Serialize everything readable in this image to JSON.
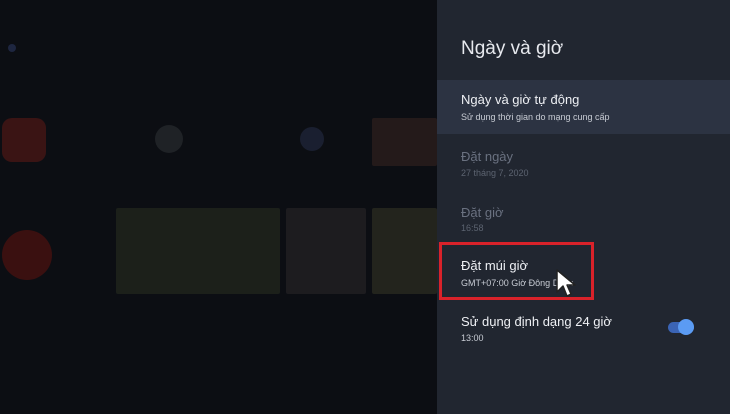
{
  "panel": {
    "title": "Ngày và giờ",
    "items": [
      {
        "title": "Ngày và giờ tự động",
        "subtitle": "Sử dụng thời gian do mạng cung cấp",
        "state": "selected"
      },
      {
        "title": "Đặt ngày",
        "subtitle": "27 tháng 7, 2020",
        "state": "disabled"
      },
      {
        "title": "Đặt giờ",
        "subtitle": "16:58",
        "state": "disabled"
      },
      {
        "title": "Đặt múi giờ",
        "subtitle": "GMT+07:00 Giờ Đông Dương",
        "state": "enabled"
      },
      {
        "title": "Sử dụng định dạng 24 giờ",
        "subtitle": "13:00",
        "state": "enabled",
        "toggle": "on"
      }
    ]
  },
  "colors": {
    "highlight": "#d9222a",
    "toggle_on": "#5b9bf3",
    "panel_bg": "#212630"
  }
}
